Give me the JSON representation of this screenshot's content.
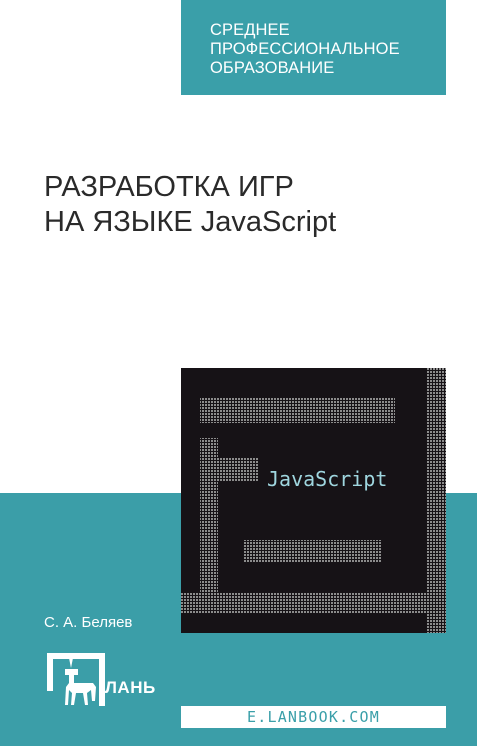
{
  "series": {
    "lines": [
      "СРЕДНЕЕ",
      "ПРОФЕССИОНАЛЬНОЕ",
      "ОБРАЗОВАНИЕ"
    ]
  },
  "book": {
    "title_lines": [
      "РАЗРАБОТКА ИГР",
      "НА ЯЗЫКЕ JavaScript"
    ],
    "author": "С. А. Беляев"
  },
  "cover_art": {
    "text": "JavaScript",
    "icon": "pixel-maze-art"
  },
  "publisher": {
    "logo_text": "ЛАНЬ",
    "logo_icon": "deer-icon",
    "url": "E.LANBOOK.COM"
  },
  "colors": {
    "teal": "#3a9fa9",
    "cover_bg": "#161216",
    "dots": "#8c8c8c",
    "art_text": "#9fd6df",
    "title": "#2a2a2a",
    "white": "#ffffff"
  }
}
